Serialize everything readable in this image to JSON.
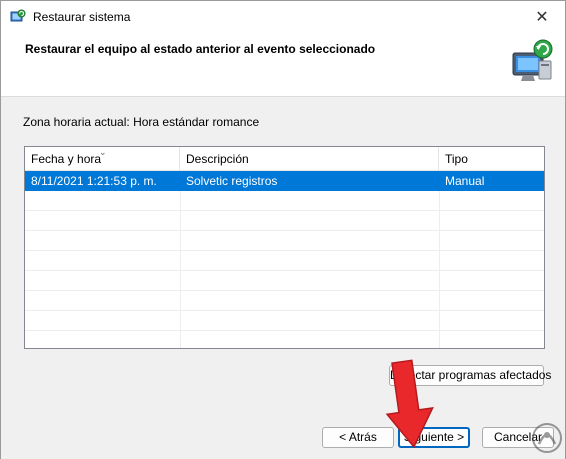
{
  "window": {
    "title": "Restaurar sistema",
    "close_symbol": "✕"
  },
  "header": {
    "title": "Restaurar el equipo al estado anterior al evento seleccionado"
  },
  "timezone": {
    "label": "Zona horaria actual: Hora estándar romance"
  },
  "table": {
    "columns": [
      "Fecha y hora",
      "Descripción",
      "Tipo"
    ],
    "rows": [
      {
        "date": "8/11/2021 1:21:53 p. m.",
        "description": "Solvetic registros",
        "type": "Manual",
        "selected": true
      }
    ]
  },
  "buttons": {
    "detect": "Detectar programas afectados",
    "back": "< Atrás",
    "next": "Siguiente >",
    "cancel": "Cancelar"
  },
  "colors": {
    "selection": "#0078d7",
    "primary_border": "#0067c0",
    "arrow": "#e8282b"
  },
  "icons": {
    "title_icon": "system-restore-icon",
    "header_icon": "computer-restore-icon",
    "close_icon": "close-icon",
    "sort_icon": "sort-chevron-icon"
  }
}
